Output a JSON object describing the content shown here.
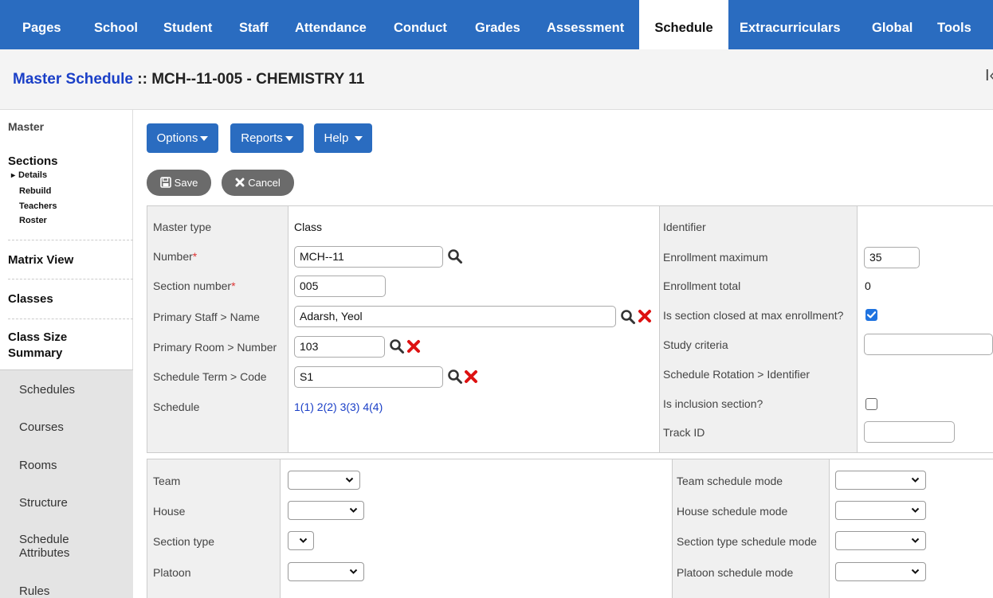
{
  "nav": {
    "tabs": [
      "Pages",
      "School",
      "Student",
      "Staff",
      "Attendance",
      "Conduct",
      "Grades",
      "Assessment",
      "Schedule",
      "Extracurriculars",
      "Global",
      "Tools"
    ],
    "active": "Schedule"
  },
  "header": {
    "title_link": "Master Schedule",
    "title_rest": " :: MCH--11-005 - CHEMISTRY 11",
    "edge_glyph": "I‹"
  },
  "sidebar": {
    "master": "Master",
    "sections": "Sections",
    "section_items": [
      "Details",
      "Rebuild",
      "Teachers",
      "Roster"
    ],
    "matrix_view": "Matrix View",
    "classes": "Classes",
    "class_size_summary_1": "Class Size",
    "class_size_summary_2": "Summary",
    "gray_items": [
      "Schedules",
      "Courses",
      "Rooms",
      "Structure",
      "Schedule",
      "Attributes",
      "Rules"
    ]
  },
  "toolbar": {
    "options": "Options",
    "reports": "Reports",
    "help": "Help",
    "save": "Save",
    "cancel": "Cancel"
  },
  "form_left": {
    "master_type_label": "Master type",
    "master_type_value": "Class",
    "number_label": "Number",
    "number_value": "MCH--11",
    "section_number_label": "Section number",
    "section_number_value": "005",
    "primary_staff_label": "Primary Staff > Name",
    "primary_staff_value": "Adarsh, Yeol",
    "primary_room_label": "Primary Room > Number",
    "primary_room_value": "103",
    "schedule_term_label": "Schedule Term > Code",
    "schedule_term_value": "S1",
    "schedule_label": "Schedule",
    "schedule_value": "1(1) 2(2) 3(3) 4(4)",
    "required_mark": "*"
  },
  "form_right": {
    "identifier_label": "Identifier",
    "enrollment_max_label": "Enrollment maximum",
    "enrollment_max_value": "35",
    "enrollment_total_label": "Enrollment total",
    "enrollment_total_value": "0",
    "section_closed_label": "Is section closed at max enrollment?",
    "section_closed_checked": true,
    "study_criteria_label": "Study criteria",
    "study_criteria_value": "",
    "rotation_label": "Schedule Rotation > Identifier",
    "inclusion_label": "Is inclusion section?",
    "inclusion_checked": false,
    "track_id_label": "Track ID",
    "track_id_value": ""
  },
  "form_bottom": {
    "team_label": "Team",
    "house_label": "House",
    "section_type_label": "Section type",
    "platoon_label": "Platoon",
    "team_mode_label": "Team schedule mode",
    "house_mode_label": "House schedule mode",
    "section_type_mode_label": "Section type schedule mode",
    "platoon_mode_label": "Platoon schedule mode"
  },
  "colors": {
    "nav_blue": "#2a6cc0",
    "link_blue": "#1a3fc7",
    "required_red": "#d33",
    "clear_icon_red": "#d11"
  },
  "icons": [
    "search-icon",
    "clear-icon",
    "save-icon",
    "close-icon",
    "chevron-down-icon",
    "caret-down-icon",
    "checkbox-icon"
  ]
}
